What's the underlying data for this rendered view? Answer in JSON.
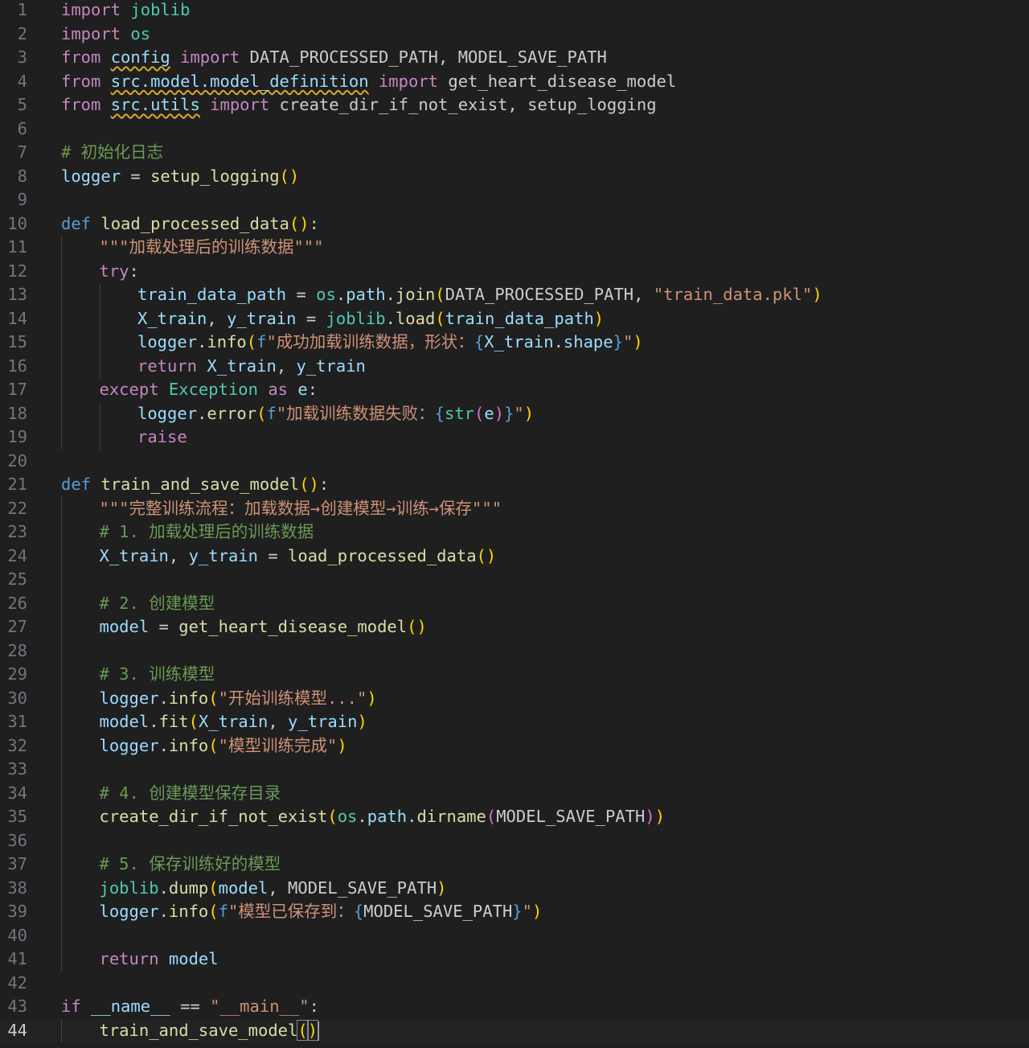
{
  "editor": {
    "language": "python",
    "active_line": 44,
    "colors": {
      "background": "#1f1f1f",
      "kw": "#c586c0",
      "def": "#569cd6",
      "fn": "#dcdcaa",
      "var": "#9cdcfe",
      "mod": "#4ec9b0",
      "cls": "#4ec9b0",
      "str": "#ce9178",
      "com": "#6a9955",
      "br": "#ffd700",
      "br2": "#da70d6",
      "br3": "#179fff",
      "num": "#b5cea8"
    },
    "lines": [
      {
        "n": "1",
        "ind": 0,
        "t": [
          [
            "kw",
            "import"
          ],
          [
            "p",
            " "
          ],
          [
            "mod",
            "joblib"
          ]
        ]
      },
      {
        "n": "2",
        "ind": 0,
        "t": [
          [
            "kw",
            "import"
          ],
          [
            "p",
            " "
          ],
          [
            "mod",
            "os"
          ]
        ]
      },
      {
        "n": "3",
        "ind": 0,
        "t": [
          [
            "kw",
            "from"
          ],
          [
            "p",
            " "
          ],
          [
            "sq",
            "config"
          ],
          [
            "p",
            " "
          ],
          [
            "kw",
            "import"
          ],
          [
            "p",
            " DATA_PROCESSED_PATH, MODEL_SAVE_PATH"
          ]
        ]
      },
      {
        "n": "4",
        "ind": 0,
        "t": [
          [
            "kw",
            "from"
          ],
          [
            "p",
            " "
          ],
          [
            "sq",
            "src.model.model_definition"
          ],
          [
            "p",
            " "
          ],
          [
            "kw",
            "import"
          ],
          [
            "p",
            " get_heart_disease_model"
          ]
        ]
      },
      {
        "n": "5",
        "ind": 0,
        "t": [
          [
            "kw",
            "from"
          ],
          [
            "p",
            " "
          ],
          [
            "sq",
            "src.utils"
          ],
          [
            "p",
            " "
          ],
          [
            "kw",
            "import"
          ],
          [
            "p",
            " create_dir_if_not_exist, setup_logging"
          ]
        ]
      },
      {
        "n": "6",
        "ind": 0,
        "t": []
      },
      {
        "n": "7",
        "ind": 0,
        "t": [
          [
            "com",
            "# 初始化日志"
          ]
        ]
      },
      {
        "n": "8",
        "ind": 0,
        "t": [
          [
            "var",
            "logger"
          ],
          [
            "p",
            " = "
          ],
          [
            "fn",
            "setup_logging"
          ],
          [
            "br",
            "()"
          ]
        ]
      },
      {
        "n": "9",
        "ind": 0,
        "t": []
      },
      {
        "n": "10",
        "ind": 0,
        "t": [
          [
            "def",
            "def"
          ],
          [
            "p",
            " "
          ],
          [
            "fn",
            "load_processed_data"
          ],
          [
            "br",
            "()"
          ],
          [
            "p",
            ":"
          ]
        ]
      },
      {
        "n": "11",
        "ind": 1,
        "t": [
          [
            "str",
            "\"\"\"加载处理后的训练数据\"\"\""
          ]
        ]
      },
      {
        "n": "12",
        "ind": 1,
        "t": [
          [
            "kw",
            "try"
          ],
          [
            "p",
            ":"
          ]
        ]
      },
      {
        "n": "13",
        "ind": 2,
        "t": [
          [
            "var",
            "train_data_path"
          ],
          [
            "p",
            " = "
          ],
          [
            "mod",
            "os"
          ],
          [
            "p",
            "."
          ],
          [
            "var",
            "path"
          ],
          [
            "p",
            "."
          ],
          [
            "fn",
            "join"
          ],
          [
            "br",
            "("
          ],
          [
            "p",
            "DATA_PROCESSED_PATH, "
          ],
          [
            "str",
            "\"train_data.pkl\""
          ],
          [
            "br",
            ")"
          ]
        ]
      },
      {
        "n": "14",
        "ind": 2,
        "t": [
          [
            "var",
            "X_train"
          ],
          [
            "p",
            ", "
          ],
          [
            "var",
            "y_train"
          ],
          [
            "p",
            " = "
          ],
          [
            "mod",
            "joblib"
          ],
          [
            "p",
            "."
          ],
          [
            "fn",
            "load"
          ],
          [
            "br",
            "("
          ],
          [
            "var",
            "train_data_path"
          ],
          [
            "br",
            ")"
          ]
        ]
      },
      {
        "n": "15",
        "ind": 2,
        "t": [
          [
            "var",
            "logger"
          ],
          [
            "p",
            "."
          ],
          [
            "fn",
            "info"
          ],
          [
            "br",
            "("
          ],
          [
            "def",
            "f"
          ],
          [
            "str",
            "\"成功加载训练数据，形状："
          ],
          [
            "def",
            "{"
          ],
          [
            "var",
            "X_train"
          ],
          [
            "p",
            "."
          ],
          [
            "var",
            "shape"
          ],
          [
            "def",
            "}"
          ],
          [
            "str",
            "\""
          ],
          [
            "br",
            ")"
          ]
        ]
      },
      {
        "n": "16",
        "ind": 2,
        "t": [
          [
            "kw",
            "return"
          ],
          [
            "p",
            " "
          ],
          [
            "var",
            "X_train"
          ],
          [
            "p",
            ", "
          ],
          [
            "var",
            "y_train"
          ]
        ]
      },
      {
        "n": "17",
        "ind": 1,
        "t": [
          [
            "kw",
            "except"
          ],
          [
            "p",
            " "
          ],
          [
            "cls",
            "Exception"
          ],
          [
            "p",
            " "
          ],
          [
            "kw",
            "as"
          ],
          [
            "p",
            " "
          ],
          [
            "var",
            "e"
          ],
          [
            "p",
            ":"
          ]
        ]
      },
      {
        "n": "18",
        "ind": 2,
        "t": [
          [
            "var",
            "logger"
          ],
          [
            "p",
            "."
          ],
          [
            "fn",
            "error"
          ],
          [
            "br",
            "("
          ],
          [
            "def",
            "f"
          ],
          [
            "str",
            "\"加载训练数据失败："
          ],
          [
            "def",
            "{"
          ],
          [
            "cls",
            "str"
          ],
          [
            "br2",
            "("
          ],
          [
            "var",
            "e"
          ],
          [
            "br2",
            ")"
          ],
          [
            "def",
            "}"
          ],
          [
            "str",
            "\""
          ],
          [
            "br",
            ")"
          ]
        ]
      },
      {
        "n": "19",
        "ind": 2,
        "t": [
          [
            "kw",
            "raise"
          ]
        ]
      },
      {
        "n": "20",
        "ind": 0,
        "t": []
      },
      {
        "n": "21",
        "ind": 0,
        "t": [
          [
            "def",
            "def"
          ],
          [
            "p",
            " "
          ],
          [
            "fn",
            "train_and_save_model"
          ],
          [
            "br",
            "()"
          ],
          [
            "p",
            ":"
          ]
        ]
      },
      {
        "n": "22",
        "ind": 1,
        "t": [
          [
            "str",
            "\"\"\"完整训练流程：加载数据→创建模型→训练→保存\"\"\""
          ]
        ]
      },
      {
        "n": "23",
        "ind": 1,
        "t": [
          [
            "com",
            "# 1. 加载处理后的训练数据"
          ]
        ]
      },
      {
        "n": "24",
        "ind": 1,
        "t": [
          [
            "var",
            "X_train"
          ],
          [
            "p",
            ", "
          ],
          [
            "var",
            "y_train"
          ],
          [
            "p",
            " = "
          ],
          [
            "fn",
            "load_processed_data"
          ],
          [
            "br",
            "()"
          ]
        ]
      },
      {
        "n": "25",
        "ind": 1,
        "t": []
      },
      {
        "n": "26",
        "ind": 1,
        "t": [
          [
            "com",
            "# 2. 创建模型"
          ]
        ]
      },
      {
        "n": "27",
        "ind": 1,
        "t": [
          [
            "var",
            "model"
          ],
          [
            "p",
            " = "
          ],
          [
            "fn",
            "get_heart_disease_model"
          ],
          [
            "br",
            "()"
          ]
        ]
      },
      {
        "n": "28",
        "ind": 1,
        "t": []
      },
      {
        "n": "29",
        "ind": 1,
        "t": [
          [
            "com",
            "# 3. 训练模型"
          ]
        ]
      },
      {
        "n": "30",
        "ind": 1,
        "t": [
          [
            "var",
            "logger"
          ],
          [
            "p",
            "."
          ],
          [
            "fn",
            "info"
          ],
          [
            "br",
            "("
          ],
          [
            "str",
            "\"开始训练模型...\""
          ],
          [
            "br",
            ")"
          ]
        ]
      },
      {
        "n": "31",
        "ind": 1,
        "t": [
          [
            "var",
            "model"
          ],
          [
            "p",
            "."
          ],
          [
            "fn",
            "fit"
          ],
          [
            "br",
            "("
          ],
          [
            "var",
            "X_train"
          ],
          [
            "p",
            ", "
          ],
          [
            "var",
            "y_train"
          ],
          [
            "br",
            ")"
          ]
        ]
      },
      {
        "n": "32",
        "ind": 1,
        "t": [
          [
            "var",
            "logger"
          ],
          [
            "p",
            "."
          ],
          [
            "fn",
            "info"
          ],
          [
            "br",
            "("
          ],
          [
            "str",
            "\"模型训练完成\""
          ],
          [
            "br",
            ")"
          ]
        ]
      },
      {
        "n": "33",
        "ind": 1,
        "t": []
      },
      {
        "n": "34",
        "ind": 1,
        "t": [
          [
            "com",
            "# 4. 创建模型保存目录"
          ]
        ]
      },
      {
        "n": "35",
        "ind": 1,
        "t": [
          [
            "fn",
            "create_dir_if_not_exist"
          ],
          [
            "br",
            "("
          ],
          [
            "mod",
            "os"
          ],
          [
            "p",
            "."
          ],
          [
            "var",
            "path"
          ],
          [
            "p",
            "."
          ],
          [
            "fn",
            "dirname"
          ],
          [
            "br2",
            "("
          ],
          [
            "p",
            "MODEL_SAVE_PATH"
          ],
          [
            "br2",
            ")"
          ],
          [
            "br",
            ")"
          ]
        ]
      },
      {
        "n": "36",
        "ind": 1,
        "t": []
      },
      {
        "n": "37",
        "ind": 1,
        "t": [
          [
            "com",
            "# 5. 保存训练好的模型"
          ]
        ]
      },
      {
        "n": "38",
        "ind": 1,
        "t": [
          [
            "mod",
            "joblib"
          ],
          [
            "p",
            "."
          ],
          [
            "fn",
            "dump"
          ],
          [
            "br",
            "("
          ],
          [
            "var",
            "model"
          ],
          [
            "p",
            ", MODEL_SAVE_PATH"
          ],
          [
            "br",
            ")"
          ]
        ]
      },
      {
        "n": "39",
        "ind": 1,
        "t": [
          [
            "var",
            "logger"
          ],
          [
            "p",
            "."
          ],
          [
            "fn",
            "info"
          ],
          [
            "br",
            "("
          ],
          [
            "def",
            "f"
          ],
          [
            "str",
            "\"模型已保存到："
          ],
          [
            "def",
            "{"
          ],
          [
            "p",
            "MODEL_SAVE_PATH"
          ],
          [
            "def",
            "}"
          ],
          [
            "str",
            "\""
          ],
          [
            "br",
            ")"
          ]
        ]
      },
      {
        "n": "40",
        "ind": 1,
        "t": []
      },
      {
        "n": "41",
        "ind": 1,
        "t": [
          [
            "kw",
            "return"
          ],
          [
            "p",
            " "
          ],
          [
            "var",
            "model"
          ]
        ]
      },
      {
        "n": "42",
        "ind": 0,
        "t": []
      },
      {
        "n": "43",
        "ind": 0,
        "t": [
          [
            "kw",
            "if"
          ],
          [
            "p",
            " "
          ],
          [
            "var",
            "__name__"
          ],
          [
            "p",
            " == "
          ],
          [
            "str",
            "\"__main__\""
          ],
          [
            "p",
            ":"
          ]
        ]
      },
      {
        "n": "44",
        "ind": 1,
        "t": [
          [
            "fn",
            "train_and_save_model"
          ],
          [
            "brbox",
            "("
          ],
          [
            "brbox",
            ")"
          ],
          [
            "cursor",
            ""
          ]
        ]
      }
    ]
  }
}
